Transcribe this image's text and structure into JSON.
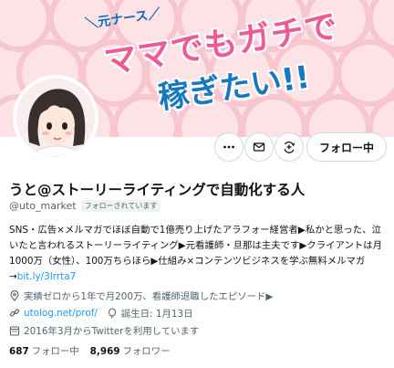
{
  "banner": {
    "subtitle": "＼元ナース／",
    "headline_line1": "ママでもガチで",
    "headline_line2": "稼ぎたい!!"
  },
  "actions": {
    "follow_label": "フォロー中"
  },
  "profile": {
    "name": "うと@ストーリーライティングで自動化する人",
    "handle": "@uto_market",
    "follows_you": "フォローされています",
    "bio_text": "SNS・広告×メルマガでほぼ自動で1億売り上げたアラフォー経営者▶私かと思った、泣いたと言われるストーリーライティング▶元看護師・旦那は主夫です▶クライアントは月1000万（女性）、100万ちらほら▶仕組み×コンテンツビジネスを学ぶ無料メルマガ→",
    "bio_link": "bit.ly/3Irrta7",
    "pinned_text": "実績ゼロから1年で月200万、看護師退職したエピソード▶",
    "website": "utolog.net/prof/",
    "birthday": "誕生日: 1月13日",
    "joined": "2016年3月からTwitterを利用しています"
  },
  "stats": {
    "following_count": "687",
    "following_label": "フォロー中",
    "followers_count": "8,969",
    "followers_label": "フォロワー"
  },
  "colors": {
    "banner_bg": "#fde3e6",
    "banner_pink": "#ef5a95",
    "banner_blue": "#1777bf",
    "link": "#1d9bf0",
    "muted": "#536471"
  },
  "icons": [
    "more-icon",
    "mail-icon",
    "notify-add-icon",
    "location-icon",
    "link-icon",
    "birthday-icon",
    "calendar-icon"
  ]
}
